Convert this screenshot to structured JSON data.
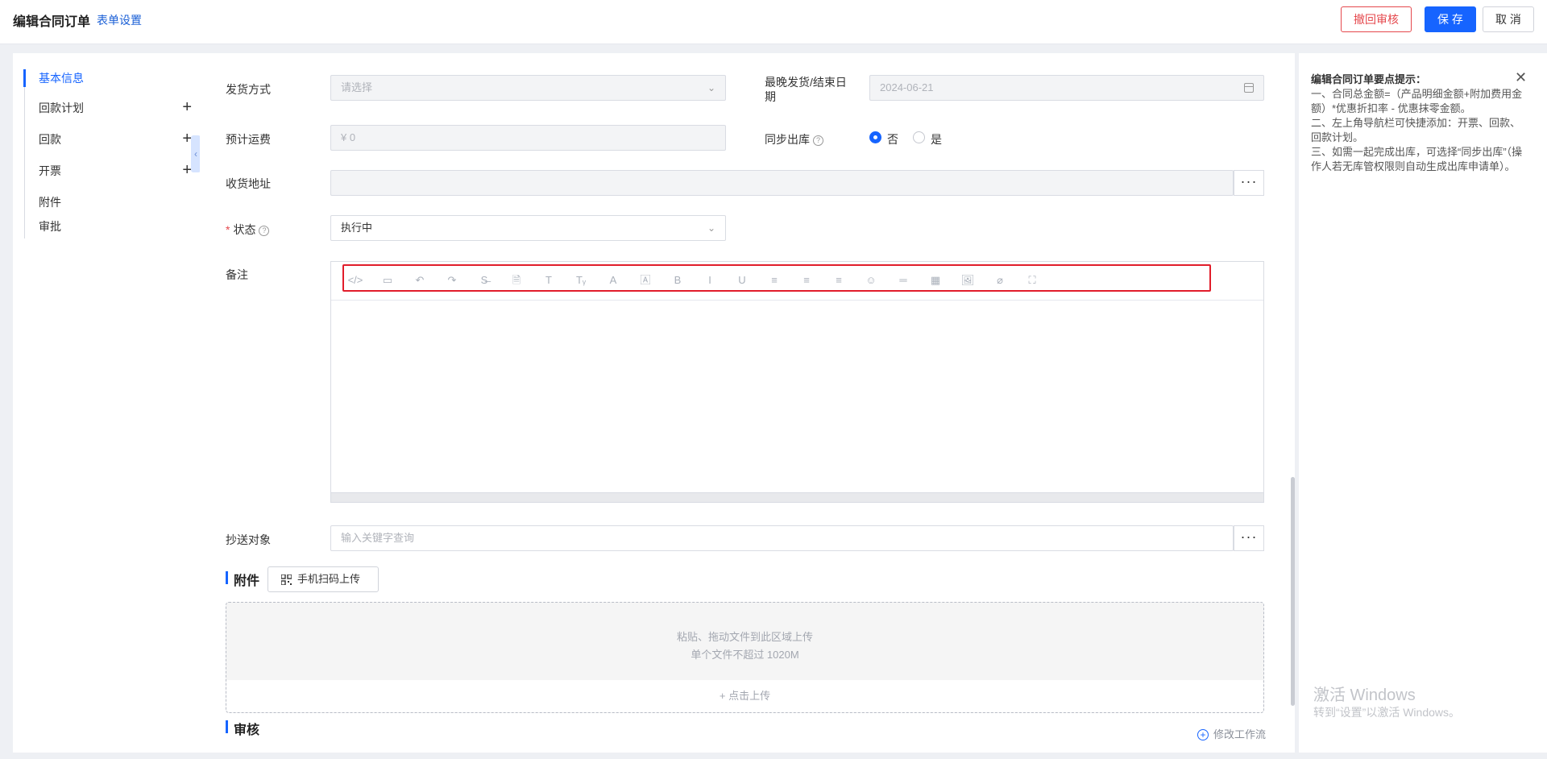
{
  "header": {
    "title": "编辑合同订单",
    "form_settings": "表单设置",
    "revoke_label": "撤回审核",
    "save_label": "保 存",
    "cancel_label": "取 消"
  },
  "nav": {
    "items": [
      {
        "label": "基本信息",
        "active": true
      },
      {
        "label": "回款计划",
        "has_add": true
      },
      {
        "label": "回款",
        "has_add": true
      },
      {
        "label": "开票",
        "has_add": true
      },
      {
        "label": "附件"
      },
      {
        "label": "审批"
      }
    ],
    "add_symbol": "+",
    "collapse_symbol": "‹"
  },
  "form": {
    "ship_method": {
      "label": "发货方式",
      "placeholder": "请选择"
    },
    "latest_ship_date": {
      "label_line1": "最晚发货/结束日",
      "label_line2": "期",
      "value": "2024-06-21"
    },
    "est_freight": {
      "label": "预计运费",
      "value": "¥  0"
    },
    "sync_outbound": {
      "label": "同步出库",
      "options": [
        "否",
        "是"
      ],
      "selected": "否"
    },
    "ship_address": {
      "label": "收货地址",
      "value": ""
    },
    "status": {
      "label": "状态",
      "value": "执行中"
    },
    "remarks": {
      "label": "备注"
    },
    "cc": {
      "label": "抄送对象",
      "placeholder": "输入关键字查询"
    },
    "dots": "···",
    "help": "?"
  },
  "editor_toolbar": [
    {
      "icon": "code-icon",
      "glyph": "</>"
    },
    {
      "icon": "template-icon",
      "glyph": "▭"
    },
    {
      "icon": "undo-icon",
      "glyph": "↶"
    },
    {
      "icon": "redo-icon",
      "glyph": "↷"
    },
    {
      "icon": "strikethrough-icon",
      "glyph": "S̶"
    },
    {
      "icon": "paste-doc-icon",
      "glyph": "🗎"
    },
    {
      "icon": "font-size-icon",
      "glyph": "T"
    },
    {
      "icon": "clear-format-icon",
      "glyph": "Tᵧ"
    },
    {
      "icon": "font-color-icon",
      "glyph": "A"
    },
    {
      "icon": "background-color-icon",
      "glyph": "🄰"
    },
    {
      "icon": "bold-icon",
      "glyph": "B"
    },
    {
      "icon": "italic-icon",
      "glyph": "I"
    },
    {
      "icon": "underline-icon",
      "glyph": "U"
    },
    {
      "icon": "align-left-icon",
      "glyph": "≡"
    },
    {
      "icon": "align-center-icon",
      "glyph": "≡"
    },
    {
      "icon": "align-right-icon",
      "glyph": "≡"
    },
    {
      "icon": "emoji-icon",
      "glyph": "☺"
    },
    {
      "icon": "horizontal-rule-icon",
      "glyph": "═"
    },
    {
      "icon": "table-icon",
      "glyph": "▦"
    },
    {
      "icon": "image-icon",
      "glyph": "🖼"
    },
    {
      "icon": "attachment-icon",
      "glyph": "⌀"
    },
    {
      "icon": "fullscreen-icon",
      "glyph": "⛶"
    }
  ],
  "attachments": {
    "title": "附件",
    "scan_upload": "手机扫码上传",
    "drop_hint": "粘贴、拖动文件到此区域上传",
    "size_limit": "单个文件不超过 1020M",
    "click_upload": "+ 点击上传"
  },
  "review": {
    "title": "审核",
    "modify_workflow": "修改工作流",
    "plus": "+"
  },
  "tips": {
    "title": "编辑合同订单要点提示：",
    "close": "✕",
    "lines": [
      "一、合同总金额=（产品明细金额+附加费用金额）*优惠折扣率 - 优惠抹零金额。",
      "二、左上角导航栏可快捷添加：开票、回款、回款计划。",
      "三、如需一起完成出库，可选择“同步出库”（操作人若无库管权限则自动生成出库申请单）。"
    ]
  },
  "watermark": {
    "line1": "激活 Windows",
    "line2": "转到“设置”以激活 Windows。"
  },
  "colors": {
    "accent": "#1664ff",
    "danger": "#e5484d",
    "highlight": "#e11d2b"
  }
}
